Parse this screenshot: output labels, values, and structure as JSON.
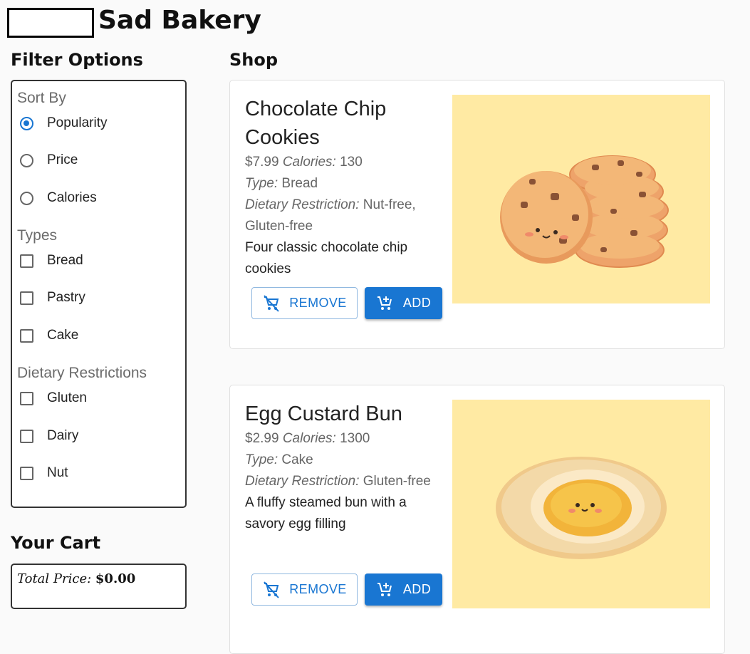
{
  "header": {
    "title": "Sad Bakery"
  },
  "filters": {
    "heading": "Filter Options",
    "sort": {
      "title": "Sort By",
      "options": [
        "Popularity",
        "Price",
        "Calories"
      ],
      "selected": "Popularity"
    },
    "types": {
      "title": "Types",
      "options": [
        "Bread",
        "Pastry",
        "Cake"
      ]
    },
    "dietary": {
      "title": "Dietary Restrictions",
      "options": [
        "Gluten",
        "Dairy",
        "Nut"
      ]
    }
  },
  "cart": {
    "heading": "Your Cart",
    "total_label": "Total Price:",
    "total_value": "$0.00"
  },
  "shop": {
    "heading": "Shop",
    "remove_label": "REMOVE",
    "add_label": "ADD",
    "type_label": "Type:",
    "calories_label": "Calories:",
    "dietary_label": "Dietary Restriction:",
    "items": [
      {
        "name": "Chocolate Chip Cookies",
        "price": "$7.99",
        "calories": "130",
        "type": "Bread",
        "dietary": "Nut-free, Gluten-free",
        "description": "Four classic chocolate chip cookies",
        "image": "cookies-illustration"
      },
      {
        "name": "Egg Custard Bun",
        "price": "$2.99",
        "calories": "1300",
        "type": "Cake",
        "dietary": "Gluten-free",
        "description": "A fluffy steamed bun with a savory egg filling",
        "image": "egg-custard-bun-illustration"
      }
    ]
  },
  "colors": {
    "primary": "#1976d2",
    "image_bg": "#ffeaa3"
  }
}
